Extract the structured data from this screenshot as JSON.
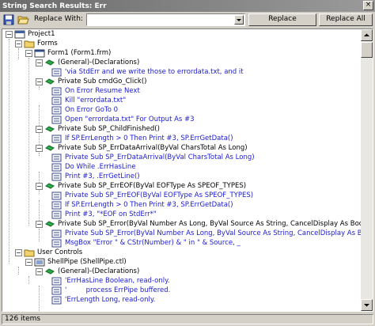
{
  "window": {
    "title": "String Search Results: Err",
    "close_glyph": "×"
  },
  "toolbar": {
    "replace_label": "Replace With:",
    "replace_value": "",
    "replace_button": "Replace",
    "replace_all_button": "Replace All"
  },
  "tree": {
    "project": "Project1",
    "forms_folder": "Forms",
    "form1": "Form1 (Form1.frm)",
    "decl1": "(General)-(Declarations)",
    "decl1_l1": "'via StdErr and we write those to errordata.txt, and it",
    "sub1": "Private Sub cmdGo_Click()",
    "sub1_l1": "On Error Resume Next",
    "sub1_l2": "Kill \"errordata.txt\"",
    "sub1_l3": "On Error GoTo 0",
    "sub1_l4": "Open \"errordata.txt\" For Output As #3",
    "sub2": "Private Sub SP_ChildFinished()",
    "sub2_l1": "If SP.ErrLength > 0 Then Print #3, SP.ErrGetData()",
    "sub3": "Private Sub SP_ErrDataArrival(ByVal CharsTotal As Long)",
    "sub3_l1": "Private Sub SP_ErrDataArrival(ByVal CharsTotal As Long)",
    "sub3_l2": "Do While .ErrHasLine",
    "sub3_l3": "Print #3, .ErrGetLine()",
    "sub4": "Private Sub SP_ErrEOF(ByVal EOFType As SPEOF_TYPES)",
    "sub4_l1": "Private Sub SP_ErrEOF(ByVal EOFType As SPEOF_TYPES)",
    "sub4_l2": "If SP.ErrLength > 0 Then Print #3, SP.ErrGetData()",
    "sub4_l3": "Print #3, \"*EOF on StdErr*\"",
    "sub5": "Private Sub SP_Error(ByVal Number As Long, ByVal Source As String, CancelDisplay As Boolean)",
    "sub5_l1": "Private Sub SP_Error(ByVal Number As Long, ByVal Source As String, CancelDisplay As Boolean)",
    "sub5_l2": "MsgBox \"Error \" & CStr(Number) & \" in \" & Source, _",
    "controls_folder": "User Controls",
    "shellpipe": "ShellPipe (ShellPipe.ctl)",
    "decl2": "(General)-(Declarations)",
    "decl2_l1": "'ErrHasLine Boolean, read-only.",
    "decl2_l2": "'         process ErrPipe buffered.",
    "decl2_l3": "'ErrLength Long, read-only."
  },
  "status": {
    "count": "126 items"
  },
  "colors": {
    "match_text": "#1a1ad0",
    "title_bar": "#8a8a8a",
    "face": "#d4d0c8"
  },
  "icons": [
    "save-icon",
    "open-folder-icon",
    "project-icon",
    "folder-icon",
    "form-icon",
    "method-icon",
    "code-line-icon",
    "usercontrol-icon"
  ]
}
